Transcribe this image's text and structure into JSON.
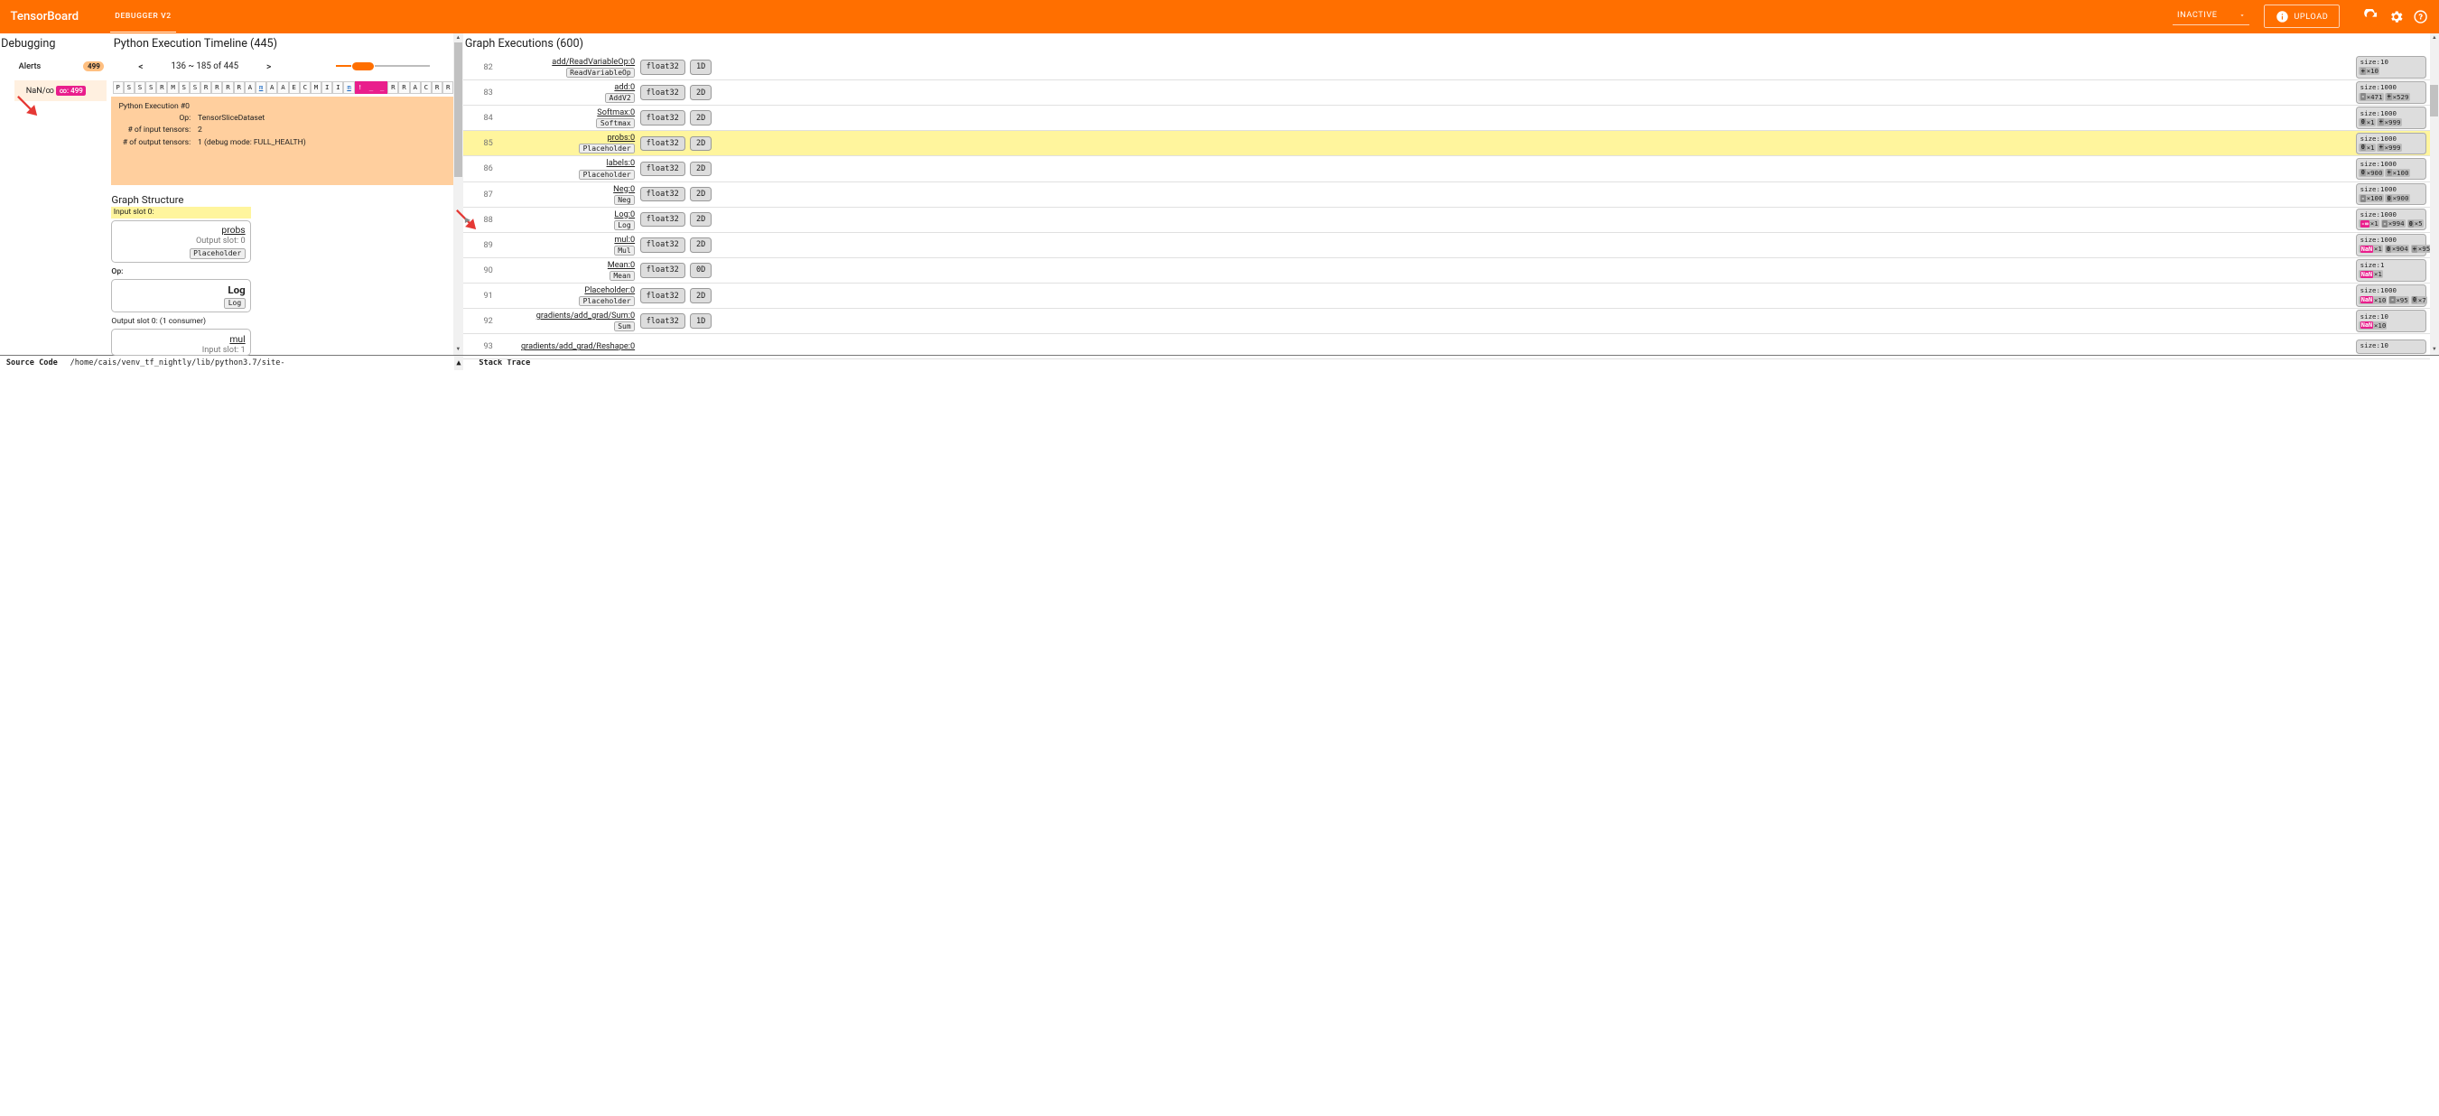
{
  "header": {
    "brand": "TensorBoard",
    "tab": "DEBUGGER V2",
    "status": "INACTIVE",
    "upload": "UPLOAD"
  },
  "alerts": {
    "title": "Debugging",
    "label": "Alerts",
    "count": "499",
    "item": {
      "name": "NaN/∞",
      "badge": "∞: 499"
    }
  },
  "timeline": {
    "title": "Python Execution Timeline (445)",
    "prev": "<",
    "range": "136 ~ 185 of 445",
    "next": ">",
    "strip": [
      "P",
      "S",
      "S",
      "S",
      "R",
      "M",
      "S",
      "S",
      "R",
      "R",
      "R",
      "R",
      "A",
      "m",
      "A",
      "A",
      "E",
      "C",
      "M",
      "I",
      "I",
      "m",
      "!",
      "_",
      "_",
      "R",
      "R",
      "A",
      "C",
      "R",
      "R"
    ],
    "pink_idx": [
      22,
      23,
      24
    ],
    "under_idx": [
      13,
      21
    ],
    "exec": {
      "head": "Python Execution #0",
      "op_l": "Op:",
      "op_v": "TensorSliceDataset",
      "in_l": "# of input tensors:",
      "in_v": "2",
      "out_l": "# of output tensors:",
      "out_v": "1   (debug mode: FULL_HEALTH)"
    },
    "graph_struct": {
      "title": "Graph Structure",
      "in_slot": "Input slot 0:",
      "in_name": "probs",
      "in_sub": "Output slot: 0",
      "in_op": "Placeholder",
      "op_l": "Op:",
      "op_name": "Log",
      "op_op": "Log",
      "out_slot": "Output slot 0: (1 consumer)",
      "out_name": "mul",
      "out_sub": "Input slot: 1"
    }
  },
  "graph": {
    "title": "Graph Executions (600)",
    "rows": [
      {
        "idx": "82",
        "name": "add/ReadVariableOp:0",
        "op": "ReadVariableOp",
        "dtype": "float32",
        "rank": "1D",
        "size": "size:10",
        "chips": [
          {
            "p": "+",
            "t": "×10"
          }
        ]
      },
      {
        "idx": "83",
        "name": "add:0",
        "op": "AddV2",
        "dtype": "float32",
        "rank": "2D",
        "size": "size:1000",
        "chips": [
          {
            "p": "-",
            "t": "×471",
            "neg": true
          },
          {
            "p": "+",
            "t": "×529"
          }
        ]
      },
      {
        "idx": "84",
        "name": "Softmax:0",
        "op": "Softmax",
        "dtype": "float32",
        "rank": "2D",
        "size": "size:1000",
        "chips": [
          {
            "p": "0",
            "t": "×1",
            "zero": true
          },
          {
            "p": "+",
            "t": "×999"
          }
        ]
      },
      {
        "idx": "85",
        "name": "probs:0",
        "op": "Placeholder",
        "dtype": "float32",
        "rank": "2D",
        "size": "size:1000",
        "hl": true,
        "chips": [
          {
            "p": "0",
            "t": "×1",
            "zero": true
          },
          {
            "p": "+",
            "t": "×999"
          }
        ]
      },
      {
        "idx": "86",
        "name": "labels:0",
        "op": "Placeholder",
        "dtype": "float32",
        "rank": "2D",
        "size": "size:1000",
        "chips": [
          {
            "p": "0",
            "t": "×900",
            "zero": true
          },
          {
            "p": "+",
            "t": "×100"
          }
        ]
      },
      {
        "idx": "87",
        "name": "Neg:0",
        "op": "Neg",
        "dtype": "float32",
        "rank": "2D",
        "size": "size:1000",
        "chips": [
          {
            "p": "-",
            "t": "×100",
            "neg": true
          },
          {
            "p": "0",
            "t": "×900",
            "zero": true
          }
        ]
      },
      {
        "idx": "88",
        "name": "Log:0",
        "op": "Log",
        "dtype": "float32",
        "rank": "2D",
        "size": "size:1000",
        "tri": true,
        "chips": [
          {
            "p": "-∞",
            "t": "×1",
            "pink": true
          },
          {
            "p": "-",
            "t": "×994",
            "neg": true
          },
          {
            "p": "0",
            "t": "×5",
            "zero": true
          }
        ]
      },
      {
        "idx": "89",
        "name": "mul:0",
        "op": "Mul",
        "dtype": "float32",
        "rank": "2D",
        "size": "size:1000",
        "chips": [
          {
            "p": "NaN",
            "t": "×1",
            "pink": true
          },
          {
            "p": "0",
            "t": "×904",
            "zero": true
          },
          {
            "p": "+",
            "t": "×95"
          }
        ]
      },
      {
        "idx": "90",
        "name": "Mean:0",
        "op": "Mean",
        "dtype": "float32",
        "rank": "0D",
        "size": "size:1",
        "chips": [
          {
            "p": "NaN",
            "t": "×1",
            "pink": true
          }
        ]
      },
      {
        "idx": "91",
        "name": "Placeholder:0",
        "op": "Placeholder",
        "dtype": "float32",
        "rank": "2D",
        "size": "size:1000",
        "chips": [
          {
            "p": "NaN",
            "t": "×10",
            "pink": true
          },
          {
            "p": "-",
            "t": "×95",
            "neg": true
          },
          {
            "p": "0",
            "t": "×7",
            "zero": true
          }
        ]
      },
      {
        "idx": "92",
        "name": "gradients/add_grad/Sum:0",
        "op": "Sum",
        "dtype": "float32",
        "rank": "1D",
        "size": "size:10",
        "chips": [
          {
            "p": "NaN",
            "t": "×10",
            "pink": true
          }
        ]
      },
      {
        "idx": "93",
        "name": "gradients/add_grad/Reshape:0",
        "op": "",
        "dtype": "",
        "rank": "",
        "size": "size:10",
        "chips": []
      }
    ]
  },
  "footer": {
    "source": "Source Code",
    "path": "/home/cais/venv_tf_nightly/lib/python3.7/site-",
    "stack": "Stack Trace"
  }
}
